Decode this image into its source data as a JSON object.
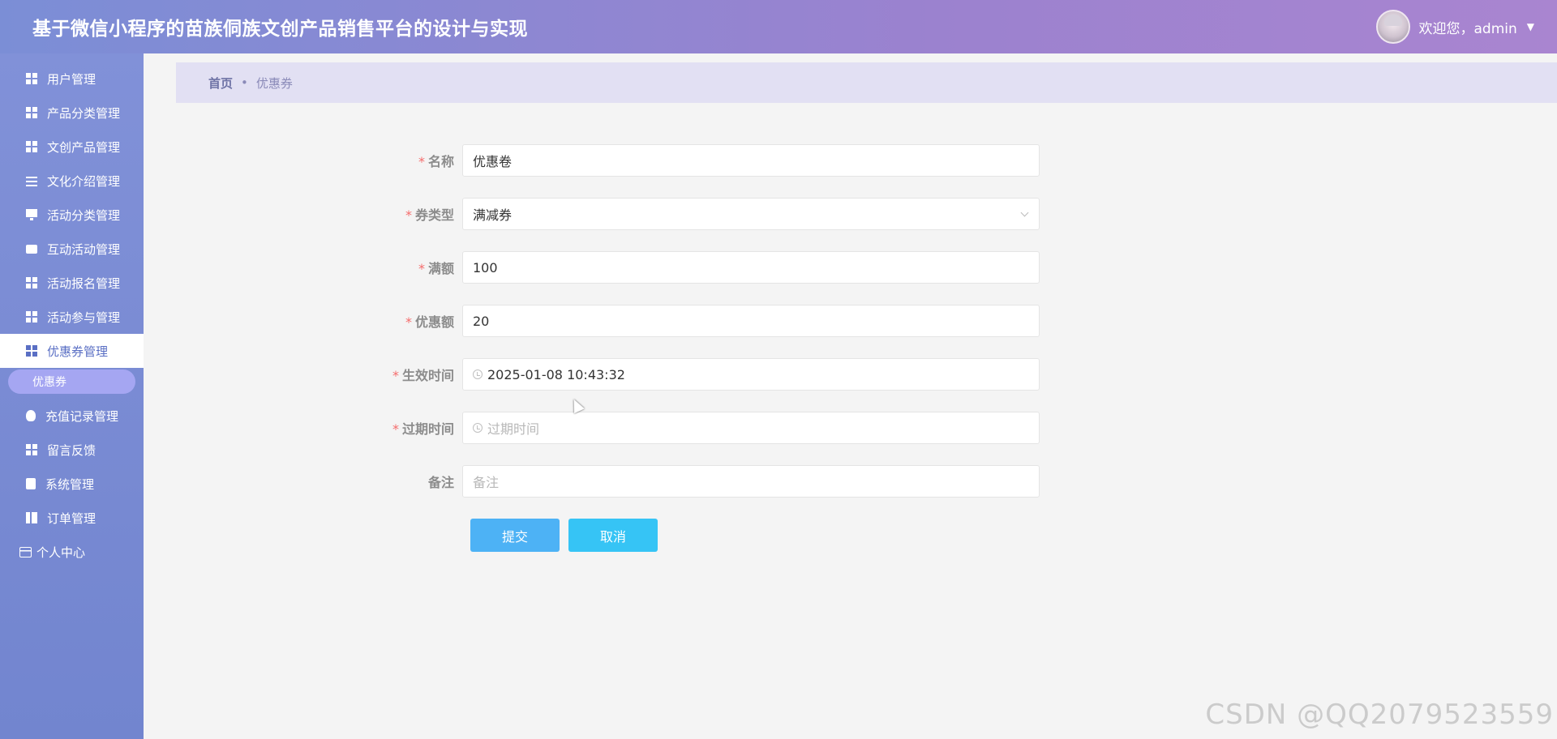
{
  "header": {
    "title": "基于微信小程序的苗族侗族文创产品销售平台的设计与实现",
    "welcome": "欢迎您，admin"
  },
  "sidebar": {
    "items": [
      {
        "label": "用户管理",
        "icon": "grid-icon"
      },
      {
        "label": "产品分类管理",
        "icon": "grid-icon"
      },
      {
        "label": "文创产品管理",
        "icon": "grid-icon"
      },
      {
        "label": "文化介绍管理",
        "icon": "sliders-icon"
      },
      {
        "label": "活动分类管理",
        "icon": "monitor-icon"
      },
      {
        "label": "互动活动管理",
        "icon": "chat-icon"
      },
      {
        "label": "活动报名管理",
        "icon": "grid-icon"
      },
      {
        "label": "活动参与管理",
        "icon": "grid-icon"
      },
      {
        "label": "优惠券管理",
        "icon": "grid-icon",
        "active": true
      },
      {
        "label": "充值记录管理",
        "icon": "bulb-icon"
      },
      {
        "label": "留言反馈",
        "icon": "grid-icon"
      },
      {
        "label": "系统管理",
        "icon": "clipboard-icon"
      },
      {
        "label": "订单管理",
        "icon": "book-icon"
      }
    ],
    "sub_item": "优惠券",
    "personal": "个人中心"
  },
  "breadcrumb": {
    "home": "首页",
    "separator": "•",
    "current": "优惠券"
  },
  "form": {
    "name": {
      "label": "名称",
      "value": "优惠卷",
      "required": true
    },
    "type": {
      "label": "券类型",
      "value": "满减券",
      "required": true
    },
    "threshold": {
      "label": "满额",
      "value": "100",
      "required": true
    },
    "discount": {
      "label": "优惠额",
      "value": "20",
      "required": true
    },
    "start_time": {
      "label": "生效时间",
      "value": "2025-01-08 10:43:32",
      "required": true
    },
    "end_time": {
      "label": "过期时间",
      "placeholder": "过期时间",
      "required": true
    },
    "remark": {
      "label": "备注",
      "placeholder": "备注",
      "required": false
    },
    "required_mark": "*",
    "submit_label": "提交",
    "cancel_label": "取消"
  },
  "watermark": "CSDN @QQ2079523559",
  "colors": {
    "header_start": "#7b8ed6",
    "header_end": "#a985d0",
    "sidebar": "#7a8bd4",
    "active_item_text": "#5a6fc4",
    "submit_button": "#4db2f5",
    "cancel_button": "#36c4f5",
    "required": "#f56c6c"
  }
}
